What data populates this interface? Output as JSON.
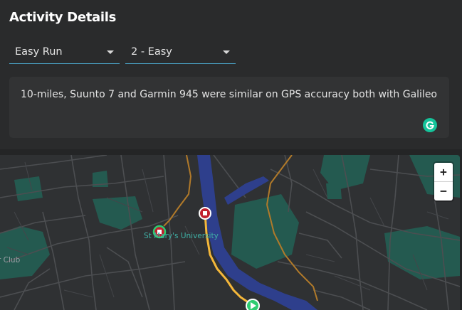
{
  "header": {
    "title": "Activity Details"
  },
  "activity_type": {
    "selected": "Easy Run"
  },
  "effort": {
    "selected": "2 - Easy"
  },
  "notes": {
    "text": "10-miles, Suunto 7 and Garmin 945 were similar on GPS accuracy both with Galileo"
  },
  "map": {
    "zoom_in_label": "+",
    "zoom_out_label": "−",
    "labels": {
      "university": "St Mary's University",
      "club": "Club"
    },
    "colors": {
      "land": "#2f3133",
      "roads": "#4c4e51",
      "green": "#245a50",
      "river": "#2e3f8c",
      "route_a": "#f4b73a",
      "route_b": "#b17a2a",
      "start": "#2ecc71",
      "stop": "#c0202e"
    }
  }
}
